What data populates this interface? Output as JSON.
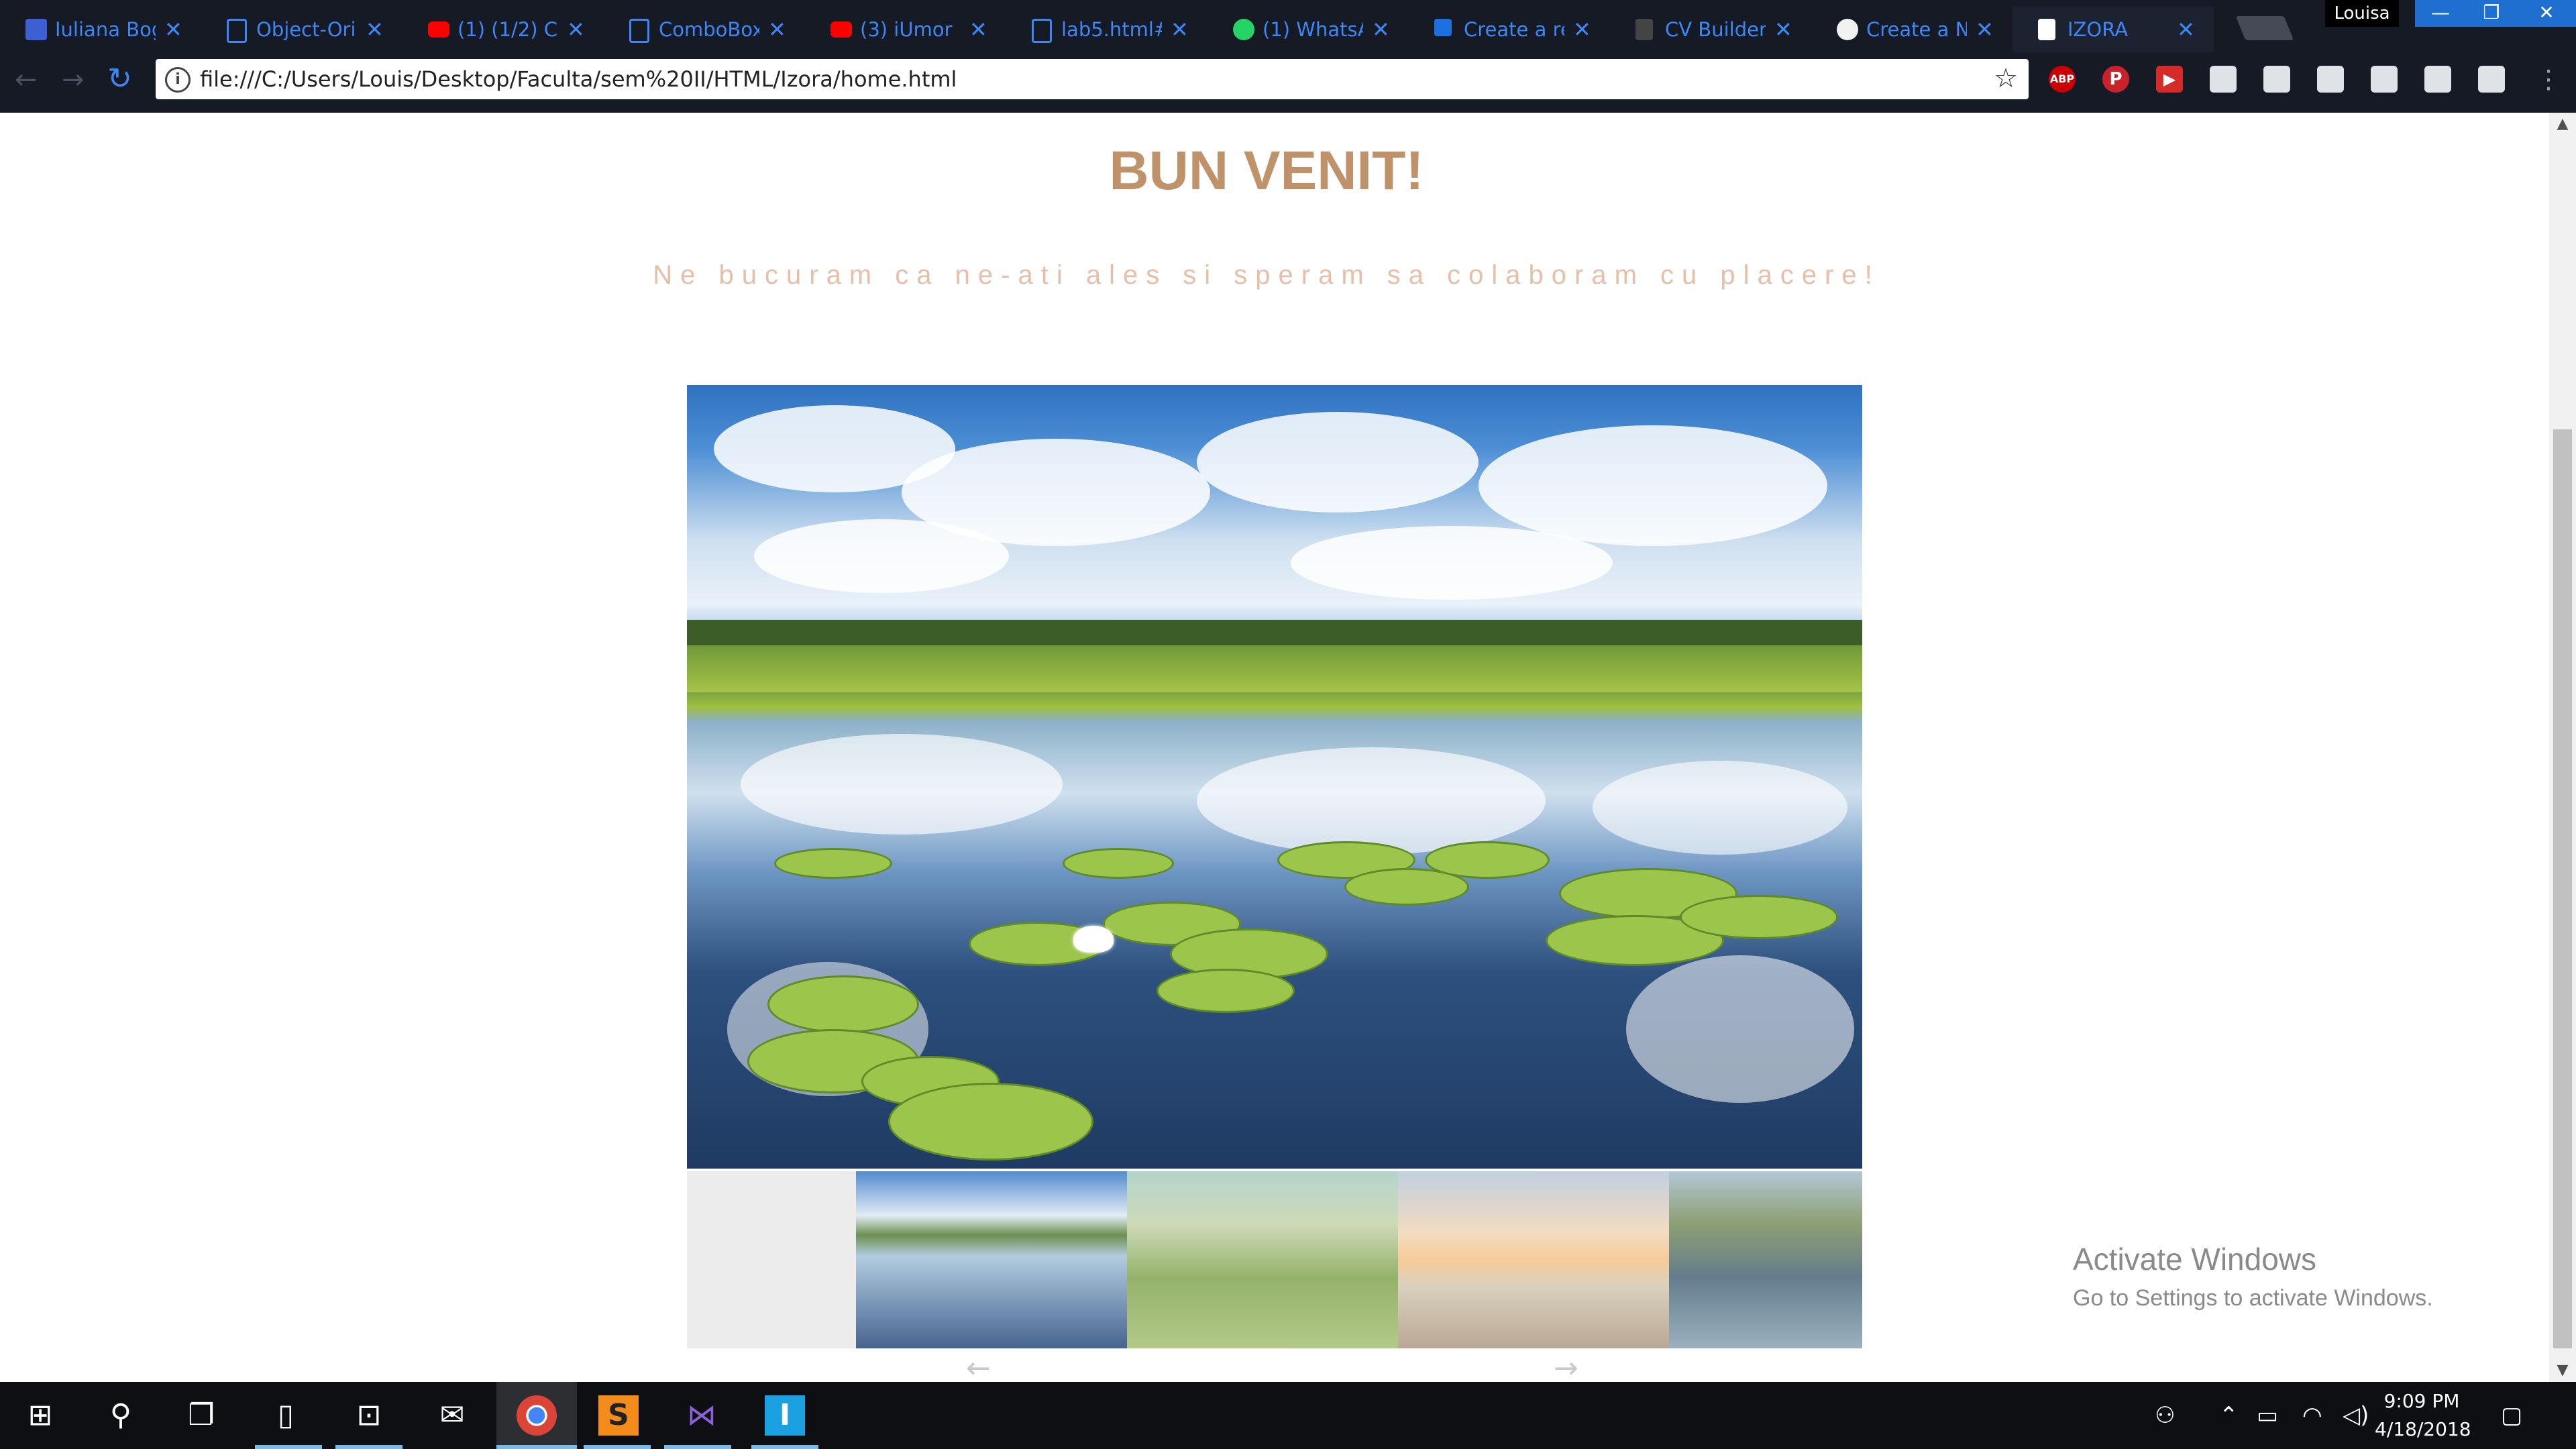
{
  "browser": {
    "tabs": [
      {
        "title": "Iuliana Bog",
        "icon": "calendar-icon",
        "color": "#3d86f5"
      },
      {
        "title": "Object-Ori",
        "icon": "document-icon",
        "color": "#3d86f5"
      },
      {
        "title": "(1) (1/2) C",
        "icon": "youtube-icon",
        "color": "#ff0000"
      },
      {
        "title": "ComboBox",
        "icon": "document-icon",
        "color": "#3d86f5"
      },
      {
        "title": "(3) iUmor",
        "icon": "youtube-icon",
        "color": "#ff0000"
      },
      {
        "title": "lab5.html#",
        "icon": "document-icon",
        "color": "#3d86f5"
      },
      {
        "title": "(1) WhatsA",
        "icon": "whatsapp-icon",
        "color": "#25d366"
      },
      {
        "title": "Create a re",
        "icon": "create-icon",
        "color": "#3d86f5"
      },
      {
        "title": "CV Builder",
        "icon": "cv-builder-icon",
        "color": "#555555"
      },
      {
        "title": "Create a N",
        "icon": "github-icon",
        "color": "#ffffff"
      },
      {
        "title": "IZORA",
        "icon": "page-icon",
        "color": "#ffffff"
      }
    ],
    "profile_name": "Louisa",
    "url": "file:///C:/Users/Louis/Desktop/Faculta/sem%20II/HTML/Izora/home.html",
    "extensions": {
      "abp": "ABP",
      "pinterest": "P",
      "red": "▶"
    }
  },
  "page": {
    "title": "BUN VENIT!",
    "subtitle": "Ne bucuram ca ne-ati ales si speram sa colaboram cu placere!",
    "arrows": {
      "prev": "←",
      "next": "→"
    }
  },
  "watermark": {
    "title": "Activate Windows",
    "subtitle": "Go to Settings to activate Windows."
  },
  "taskbar": {
    "time": "9:09 PM",
    "date": "4/18/2018"
  },
  "colors": {
    "accent_title": "#c0926a",
    "accent_subtitle": "#e6bfa8",
    "chrome_bg": "#151a24",
    "tab_text": "#3d86f5"
  }
}
